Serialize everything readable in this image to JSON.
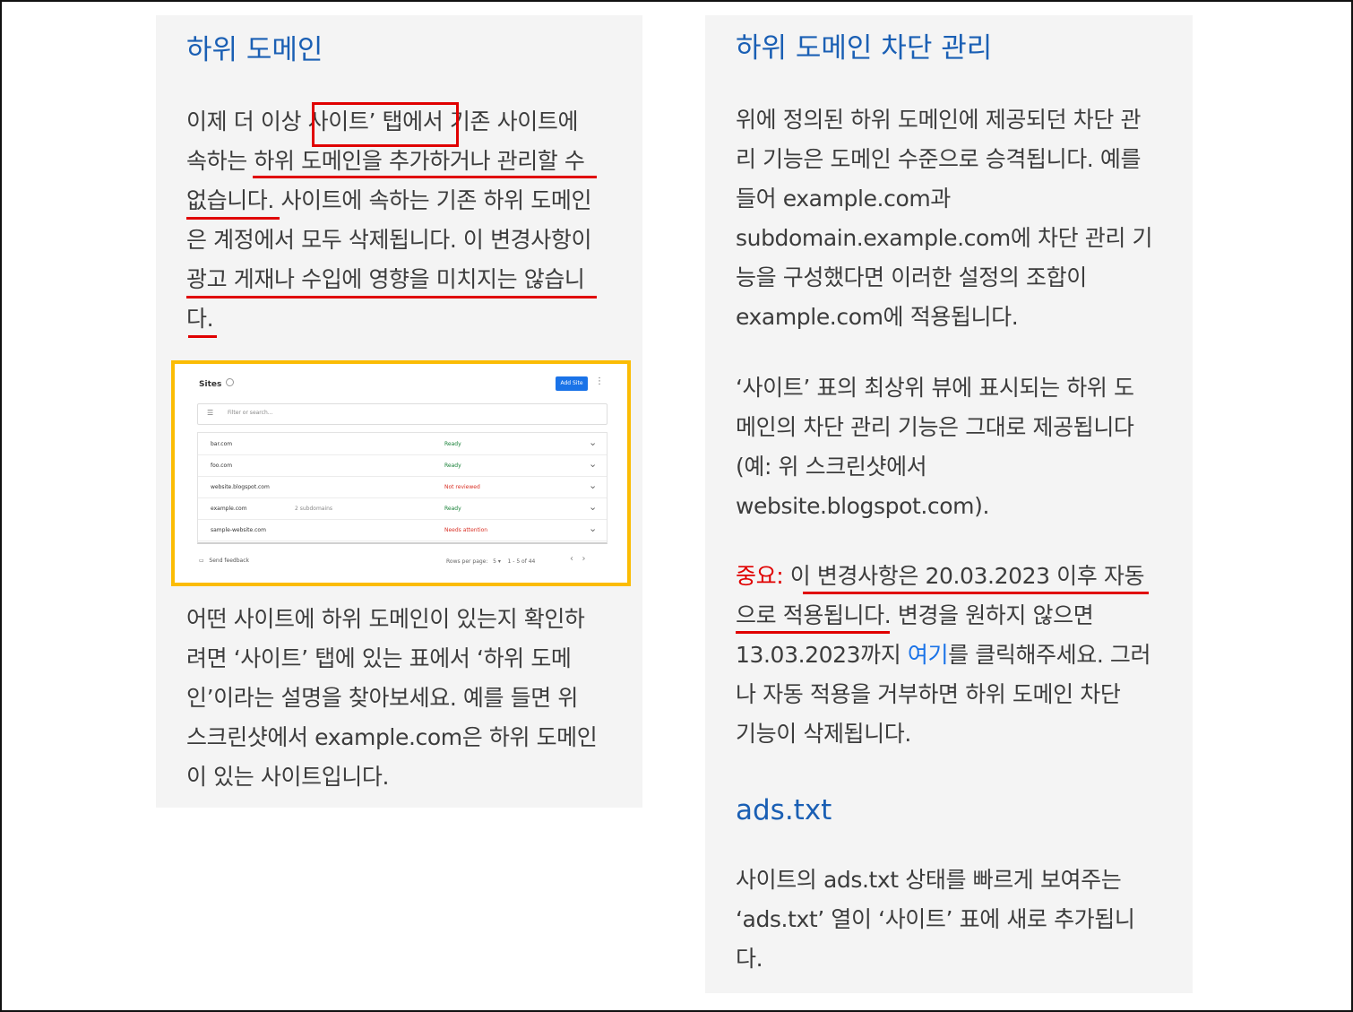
{
  "left": {
    "heading": "하위 도메인",
    "para1": [
      {
        "pre": "이제 더 이상 ",
        "boxed": "사이트’ 탭에서",
        "post": " 기존 사이트에"
      },
      "속하는 하위 도메인을 추가하거나 관리할 수",
      "없습니다. 사이트에 속하는 기존 하위 도메인",
      "은 계정에서 모두 삭제됩니다. 이 변경사항이",
      "광고 게재나 수입에 영향을 미치지는 않습니",
      "다."
    ],
    "screenshot": {
      "title": "Sites",
      "add_button": "Add Site",
      "filter_placeholder": "Filter or search...",
      "rows": [
        {
          "site": "bar.com",
          "sub": "",
          "status": "Ready",
          "color": "#188038"
        },
        {
          "site": "foo.com",
          "sub": "",
          "status": "Ready",
          "color": "#188038"
        },
        {
          "site": "website.blogspot.com",
          "sub": "",
          "status": "Not reviewed",
          "color": "#d93025"
        },
        {
          "site": "example.com",
          "sub": "2 subdomains",
          "status": "Ready",
          "color": "#188038"
        },
        {
          "site": "sample-website.com",
          "sub": "",
          "status": "Needs attention",
          "color": "#d93025"
        }
      ],
      "feedback": "Send feedback",
      "rows_per_page_label": "Rows per page:",
      "rows_per_page_value": "5",
      "pagination": "1 - 5 of 44"
    },
    "para2": [
      "어떤 사이트에 하위 도메인이 있는지 확인하",
      "려면 ‘사이트’ 탭에 있는 표에서 ‘하위 도메",
      "인’이라는 설명을 찾아보세요. 예를 들면 위",
      "스크린샷에서 example.com은 하위 도메인",
      "이 있는 사이트입니다."
    ]
  },
  "right": {
    "heading": "하위 도메인 차단 관리",
    "para1": [
      "위에 정의된 하위 도메인에 제공되던 차단 관",
      "리 기능은 도메인 수준으로 승격됩니다. 예를",
      "들어 example.com과",
      "subdomain.example.com에 차단 관리 기",
      "능을 구성했다면 이러한 설정의 조합이",
      "example.com에 적용됩니다."
    ],
    "para2": [
      "‘사이트’ 표의 최상위 뷰에 표시되는 하위 도",
      "메인의 차단 관리 기능은 그대로 제공됩니다",
      "(예: 위 스크린샷에서",
      "website.blogspot.com)."
    ],
    "para3": {
      "important_label": "중요:",
      "line1_rest": " 이 변경사항은 20.03.2023 이후 자동",
      "line2_underlined": "으로 적용됩니다",
      "line2_rest": ". 변경을 원하지 않으면",
      "line3_pre": "13.03.2023까지 ",
      "line3_link": "여기",
      "line3_post": "를 클릭해주세요. 그러",
      "line4": "나 자동 적용을 거부하면 하위 도메인 차단",
      "line5": "기능이 삭제됩니다."
    },
    "heading2": "ads.txt",
    "para4": [
      "사이트의 ads.txt 상태를 빠르게 보여주는",
      "‘ads.txt’ 열이 ‘사이트’ 표에 새로 추가됩니",
      "다."
    ]
  },
  "colors": {
    "heading": "#1a5fb4",
    "annotation_red": "#e00000",
    "highlight_frame": "#fbbc04",
    "link": "#1a73e8"
  }
}
